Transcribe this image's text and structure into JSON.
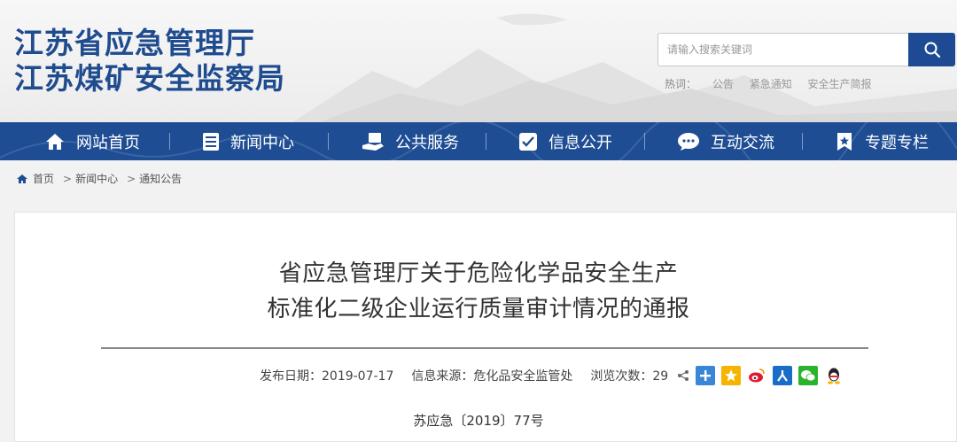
{
  "header": {
    "org_line1": "江苏省应急管理厅",
    "org_line2": "江苏煤矿安全监察局"
  },
  "search": {
    "placeholder": "请输入搜索关键词",
    "hot_label": "热词：",
    "hot_words": [
      "公告",
      "紧急通知",
      "安全生产简报"
    ]
  },
  "nav": {
    "items": [
      {
        "label": "网站首页",
        "icon": "home-icon"
      },
      {
        "label": "新闻中心",
        "icon": "news-icon"
      },
      {
        "label": "公共服务",
        "icon": "service-icon"
      },
      {
        "label": "信息公开",
        "icon": "info-icon"
      },
      {
        "label": "互动交流",
        "icon": "chat-icon"
      },
      {
        "label": "专题专栏",
        "icon": "bookmark-icon"
      }
    ]
  },
  "breadcrumb": {
    "items": [
      "首页",
      "新闻中心",
      "通知公告"
    ],
    "separator": ">"
  },
  "article": {
    "title_line1": "省应急管理厅关于危险化学品安全生产",
    "title_line2": "标准化二级企业运行质量审计情况的通报",
    "publish_label": "发布日期：2019-07-17",
    "source_label": "信息来源：危化品安全监管处",
    "views_label": "浏览次数：29",
    "doc_number": "苏应急〔2019〕77号"
  },
  "share": {
    "icons": [
      "share-icon",
      "plus-share-icon",
      "qzone-icon",
      "weibo-icon",
      "renren-icon",
      "wechat-icon",
      "qq-icon"
    ]
  },
  "colors": {
    "brand_blue": "#1e4d94",
    "logo_blue": "#1f4b8f"
  }
}
